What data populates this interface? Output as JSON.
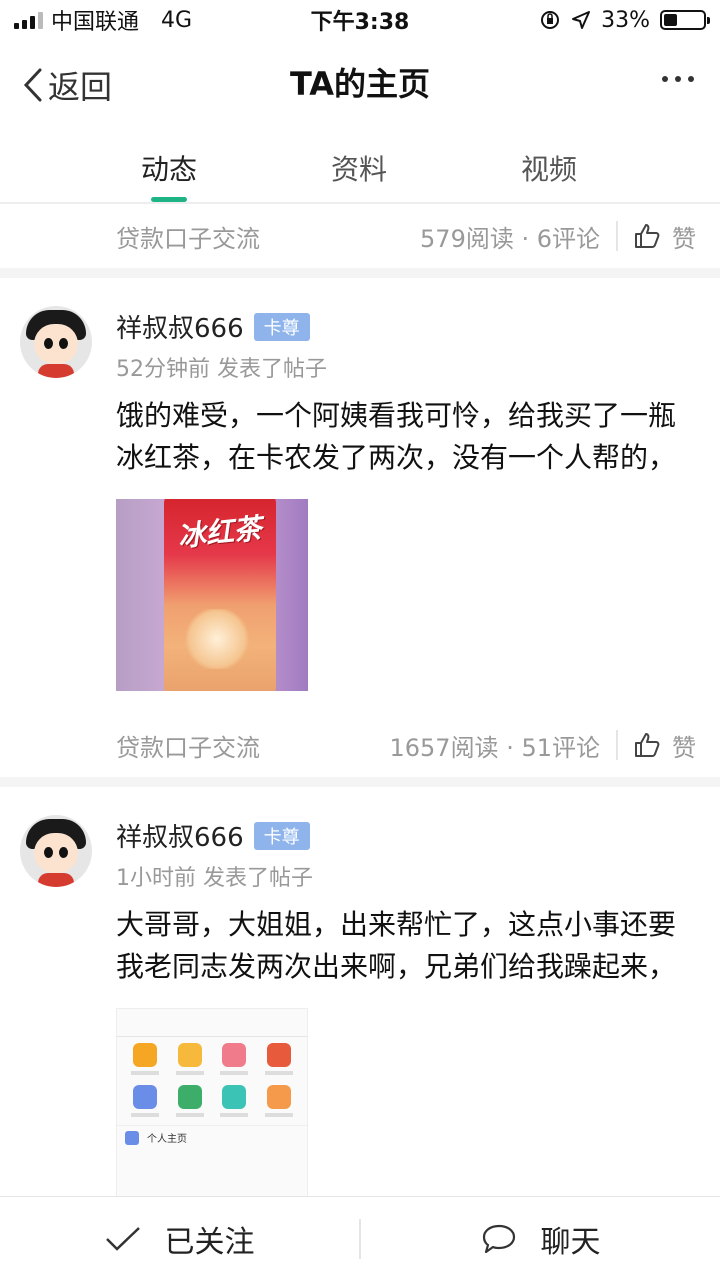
{
  "status_bar": {
    "carrier": "中国联通",
    "network": "4G",
    "time": "下午3:38",
    "battery_text": "33%",
    "battery_level": 0.33,
    "icons": [
      "signal-icon",
      "orientation-lock-icon",
      "location-icon",
      "battery-icon"
    ]
  },
  "nav": {
    "back_label": "返回",
    "title": "TA的主页",
    "more_icon": "more-dots-icon"
  },
  "tabs": [
    {
      "label": "动态",
      "active": true
    },
    {
      "label": "资料",
      "active": false
    },
    {
      "label": "视频",
      "active": false
    }
  ],
  "accent_color": "#1fb486",
  "badge_color": "#8fb4ec",
  "feed": {
    "top_meta": {
      "topic": "贷款口子交流",
      "stats": "579阅读 · 6评论",
      "like_label": "赞"
    },
    "posts": [
      {
        "username": "祥叔叔666",
        "badge": "卡尊",
        "time": "52分钟前 发表了帖子",
        "content": "饿的难受，一个阿姨看我可怜，给我买了一瓶冰红茶，在卡农发了两次，没有一个人帮的，",
        "image_text": "冰红茶",
        "meta": {
          "topic": "贷款口子交流",
          "stats": "1657阅读 · 51评论",
          "like_label": "赞"
        }
      },
      {
        "username": "祥叔叔666",
        "badge": "卡尊",
        "time": "1小时前 发表了帖子",
        "content": "大哥哥，大姐姐，出来帮忙了，这点小事还要我老同志发两次出来啊，兄弟们给我躁起来，",
        "image_row_label": "个人主页"
      }
    ]
  },
  "bottom_bar": {
    "follow_label": "已关注",
    "chat_label": "聊天"
  }
}
